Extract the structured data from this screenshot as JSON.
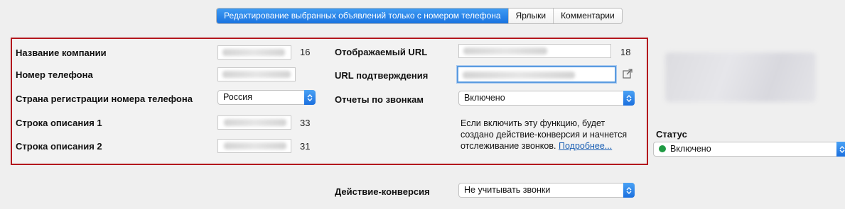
{
  "tabs": [
    {
      "label": "Редактирование выбранных объявлений только с номером телефона",
      "active": true
    },
    {
      "label": "Ярлыки",
      "active": false
    },
    {
      "label": "Комментарии",
      "active": false
    }
  ],
  "left": {
    "company_name": {
      "label": "Название компании",
      "count": "16"
    },
    "phone_number": {
      "label": "Номер телефона"
    },
    "phone_country": {
      "label": "Страна регистрации номера телефона",
      "value": "Россия"
    },
    "desc1": {
      "label": "Строка описания 1",
      "count": "33"
    },
    "desc2": {
      "label": "Строка описания 2",
      "count": "31"
    }
  },
  "right": {
    "display_url": {
      "label": "Отображаемый URL",
      "count": "18"
    },
    "verification_url": {
      "label": "URL подтверждения"
    },
    "call_reports": {
      "label": "Отчеты по звонкам",
      "value": "Включено"
    },
    "help_text": "Если включить эту функцию, будет создано действие-конверсия и начнется отслеживание звонков.",
    "help_link": "Подробнее..."
  },
  "conversion": {
    "label": "Действие-конверсия",
    "value": "Не учитывать звонки"
  },
  "status": {
    "label": "Статус",
    "value": "Включено",
    "dot_color": "#1f9a43"
  },
  "icons": {
    "open_external": "external-link-icon",
    "select_arrows": "updown-arrows-icon"
  }
}
